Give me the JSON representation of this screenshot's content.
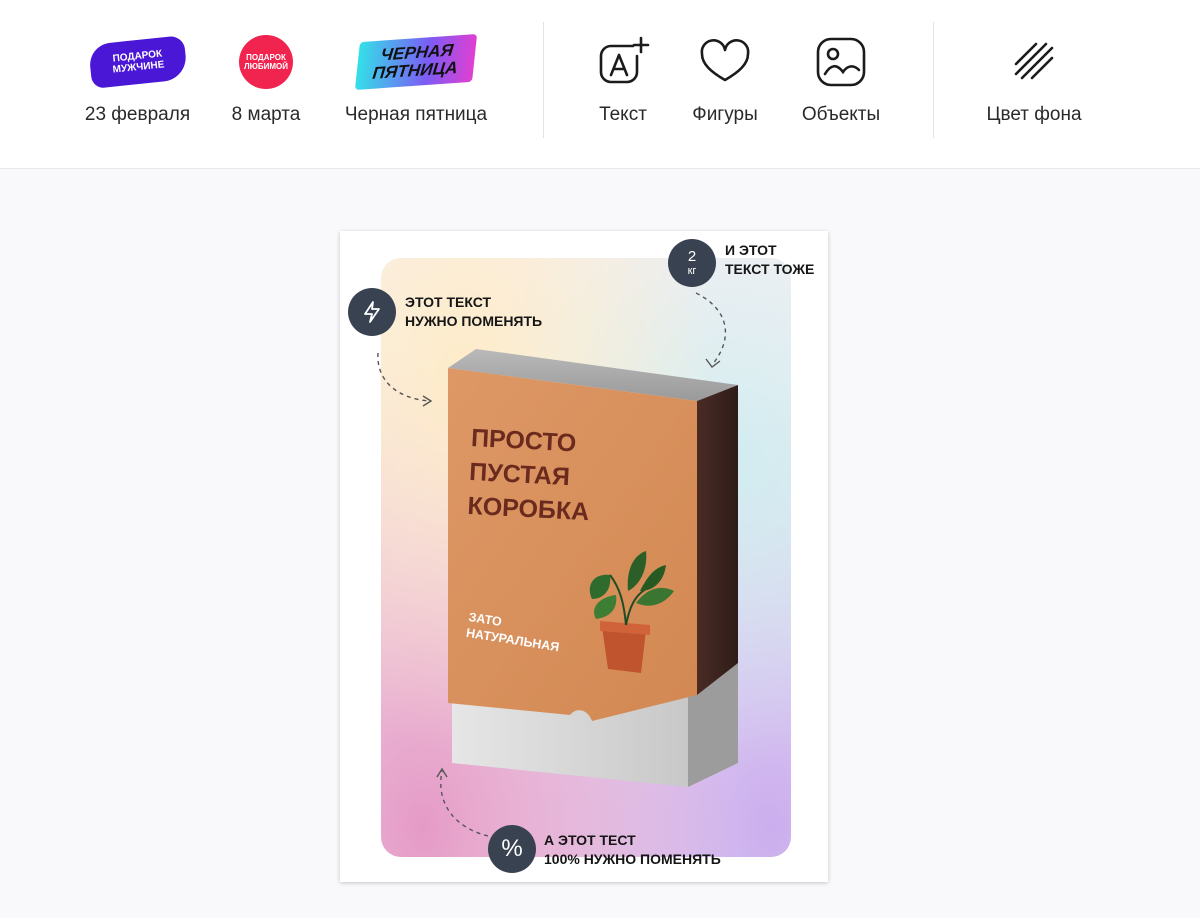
{
  "toolbar": {
    "templates": [
      {
        "label": "23 февраля",
        "sticker_lines": [
          "ПОДАРОК",
          "МУЖЧИНЕ"
        ],
        "color": "#4a17d6"
      },
      {
        "label": "8 марта",
        "sticker_lines": [
          "ПОДАРОК",
          "ЛЮБИМОЙ"
        ],
        "color": "#f0244f"
      },
      {
        "label": "Черная пятница",
        "sticker_lines": [
          "ЧЕРНАЯ",
          "ПЯТНИЦА"
        ]
      }
    ],
    "tools": [
      {
        "label": "Текст",
        "icon": "add-text-icon"
      },
      {
        "label": "Фигуры",
        "icon": "heart-shape-icon"
      },
      {
        "label": "Объекты",
        "icon": "image-icon"
      }
    ],
    "background": {
      "label": "Цвет фона",
      "icon": "diagonal-lines-icon"
    }
  },
  "canvas": {
    "callout_top_right": {
      "badge_number": "2",
      "badge_unit": "кг",
      "lines": [
        "И ЭТОТ",
        "ТЕКСТ ТОЖЕ"
      ]
    },
    "callout_left": {
      "badge_icon": "lightning-icon",
      "lines": [
        "ЭТОТ ТЕКСТ",
        "НУЖНО ПОМЕНЯТЬ"
      ]
    },
    "callout_bottom": {
      "badge_symbol": "%",
      "lines": [
        "А ЭТОТ ТЕСТ",
        "100% НУЖНО ПОМЕНЯТЬ"
      ]
    },
    "box": {
      "title_lines": [
        "ПРОСТО",
        "ПУСТАЯ",
        "КОРОБКА"
      ],
      "subtitle_lines": [
        "ЗАТО",
        "НАТУРАЛЬНАЯ"
      ]
    }
  },
  "colors": {
    "badge": "#384250",
    "box_front": "#d98f5e",
    "box_text": "#6b2a1e"
  }
}
